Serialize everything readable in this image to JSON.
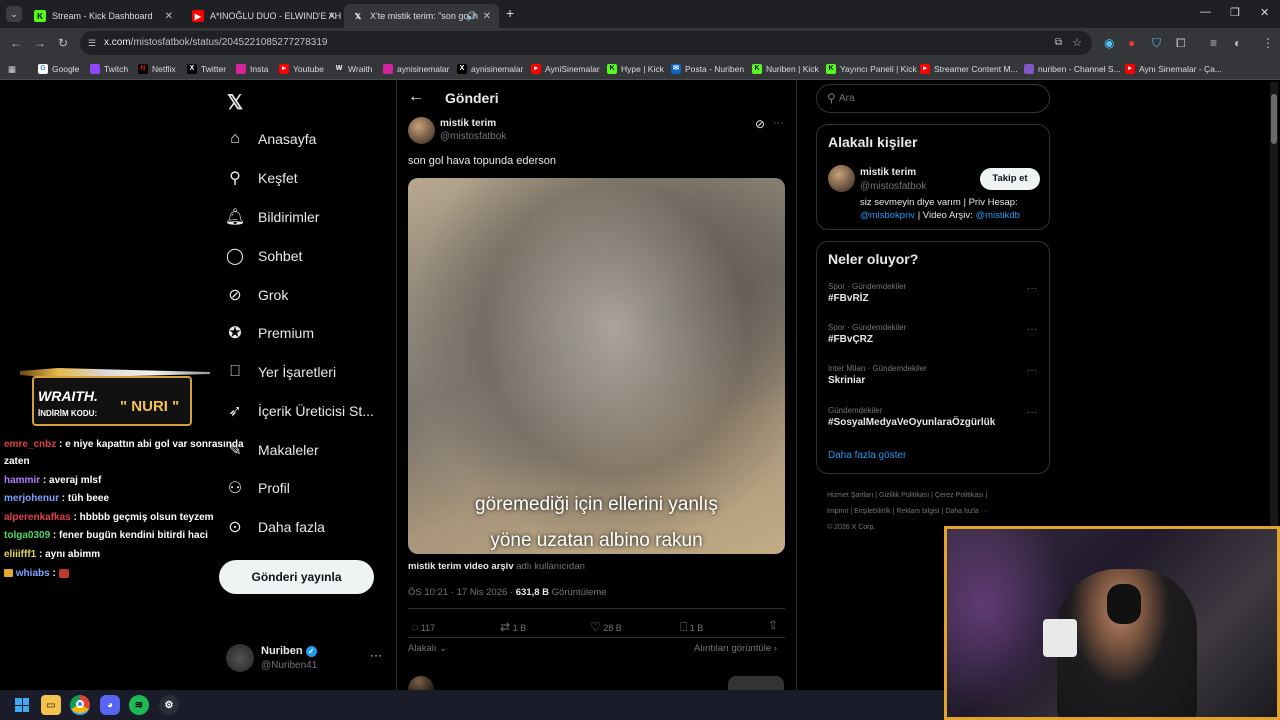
{
  "browser": {
    "tabs": [
      {
        "title": "Stream - Kick Dashboard",
        "active": false
      },
      {
        "title": "A*INOĞLU DUO - ELWIND'E AH",
        "active": false
      },
      {
        "title": "X'te mistik terim: \"son gol h",
        "active": true
      }
    ],
    "url_host": "x.com",
    "url_path": "/mistosfatbok/status/2045221085277278319",
    "bookmarks": [
      "Google",
      "Twitch",
      "Netflix",
      "Twitter",
      "Insta",
      "Youtube",
      "Wraith",
      "aynisinemalar",
      "aynisinemalar",
      "AyniSinemalar",
      "Hype | Kick",
      "Posta - Nuriben",
      "Nuriben | Kick",
      "Yayıncı Paneli | Kick",
      "Streamer Content M...",
      "nuriben - Channel S...",
      "Aynı Sinemalar - Ça..."
    ]
  },
  "nav": {
    "items": [
      "Anasayfa",
      "Keşfet",
      "Bildirimler",
      "Sohbet",
      "Grok",
      "Premium",
      "Yer İşaretleri",
      "İçerik Üreticisi St...",
      "Makaleler",
      "Profil",
      "Daha fazla"
    ],
    "post_button": "Gönderi yayınla",
    "account_name": "Nuriben",
    "account_handle": "@Nuriben41"
  },
  "post": {
    "header": "Gönderi",
    "author_name": "mistik terim",
    "author_handle": "@mistosfatbok",
    "text": "son gol hava topunda ederson",
    "caption_line1": "göremediği için ellerini yanlış",
    "caption_line2": "yöne uzatan albino rakun",
    "source_name": "mistik terim video arşiv",
    "source_suffix": "adlı kullanıcıdan",
    "timestamp": "ÖS 10:21 · 17 Nis 2026 ·",
    "views_count": "631,8 B",
    "views_label": "Görüntüleme",
    "replies": "117",
    "reposts": "1 B",
    "likes": "28 B",
    "bookmarks": "1 B",
    "related_label": "Alakalı",
    "quotes_label": "Alıntıları görüntüle"
  },
  "search": {
    "placeholder": "Ara"
  },
  "relevant": {
    "title": "Alakalı kişiler",
    "name": "mistik terim",
    "handle": "@mistosfatbok",
    "follow_label": "Takip et",
    "bio_text": "siz sevmeyin diye varım | Priv Hesap:",
    "bio_link1": "@misbokpriv",
    "bio_mid": "| Video Arşiv:",
    "bio_link2": "@mistikdb"
  },
  "trends": {
    "title": "Neler oluyor?",
    "items": [
      {
        "category": "Spor · Gündemdekiler",
        "name": "#FBvRİZ"
      },
      {
        "category": "Spor · Gündemdekiler",
        "name": "#FBvÇRZ"
      },
      {
        "category": "Inter Milan · Gündemdekiler",
        "name": "Skriniar"
      },
      {
        "category": "Gündemdekiler",
        "name": "#SosyalMedyaVeOyunlaraÖzgürlük"
      }
    ],
    "show_more": "Daha fazla göster"
  },
  "footer": {
    "links": [
      "Hizmet Şartları",
      "Gizlilik Politikası",
      "Çerez Politikası",
      "Imprint",
      "Erişilebilirlik",
      "Reklam bilgisi",
      "Daha fazla ···"
    ],
    "copyright": "© 2026 X Corp."
  },
  "overlay": {
    "promo_brand": "WRAITH.",
    "promo_label": "İNDİRİM KODU:",
    "promo_code": "\" NURI \"",
    "chat": [
      {
        "user": "emre_cnbz",
        "msg": ": e niye kapattın abi gol var sonrasında",
        "color": "#e0404a"
      },
      {
        "user": "",
        "msg": "zaten",
        "color": "#ffffff"
      },
      {
        "user": "hammir",
        "msg": ": averaj mlsf",
        "color": "#b57cff"
      },
      {
        "user": "merjohenur",
        "msg": ": tüh beee",
        "color": "#7ea1ff"
      },
      {
        "user": "alperenkafkas",
        "msg": ": hbbbb geçmiş olsun teyzem",
        "color": "#e0404a"
      },
      {
        "user": "tolga0309",
        "msg": ": fener bugün kendini bitirdi haci",
        "color": "#4cd964"
      },
      {
        "user": "eliiifff1",
        "msg": ": aynı abimm",
        "color": "#e6d65a"
      },
      {
        "user": "whiabs",
        "msg": ":",
        "color": "#7ea1ff"
      }
    ]
  }
}
